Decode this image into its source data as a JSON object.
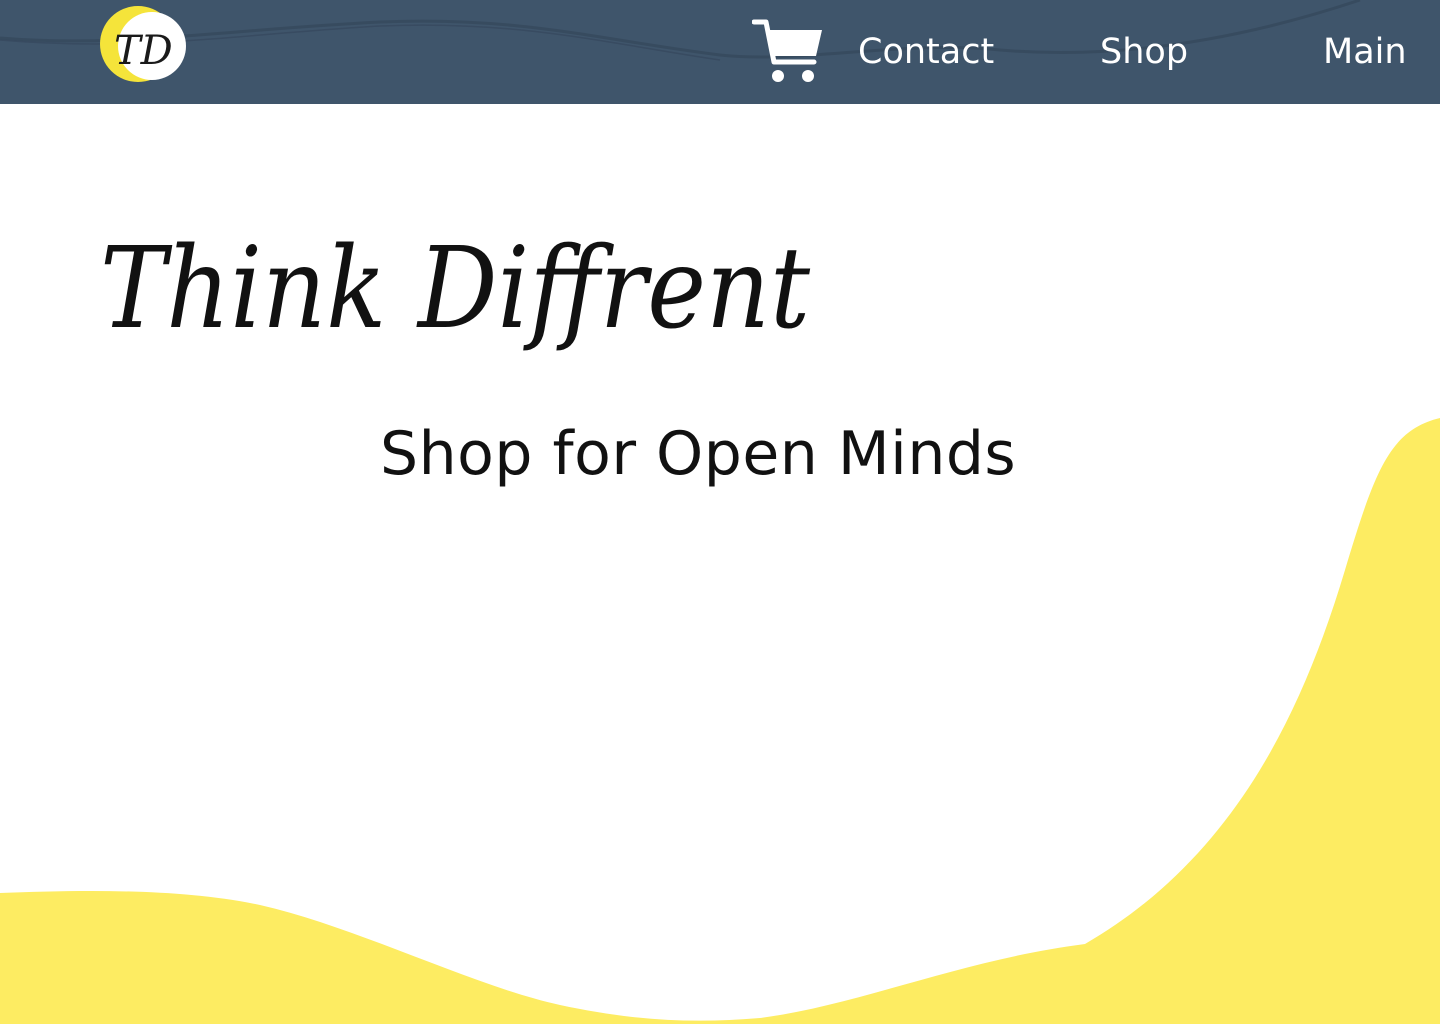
{
  "colors": {
    "header_bg": "#3f556b",
    "accent_yellow": "#fdec62",
    "logo_yellow": "#f5e43a",
    "text_dark": "#111111",
    "text_light": "#ffffff"
  },
  "header": {
    "logo": {
      "icon": "td-monogram-logo",
      "monogram": "TD"
    },
    "cart": {
      "icon": "shopping-cart-icon"
    },
    "nav": [
      {
        "label": "Contact"
      },
      {
        "label": "Shop"
      },
      {
        "label": "Main"
      }
    ]
  },
  "hero": {
    "title": "Think Diffrent",
    "subtitle": "Shop for Open Minds"
  }
}
